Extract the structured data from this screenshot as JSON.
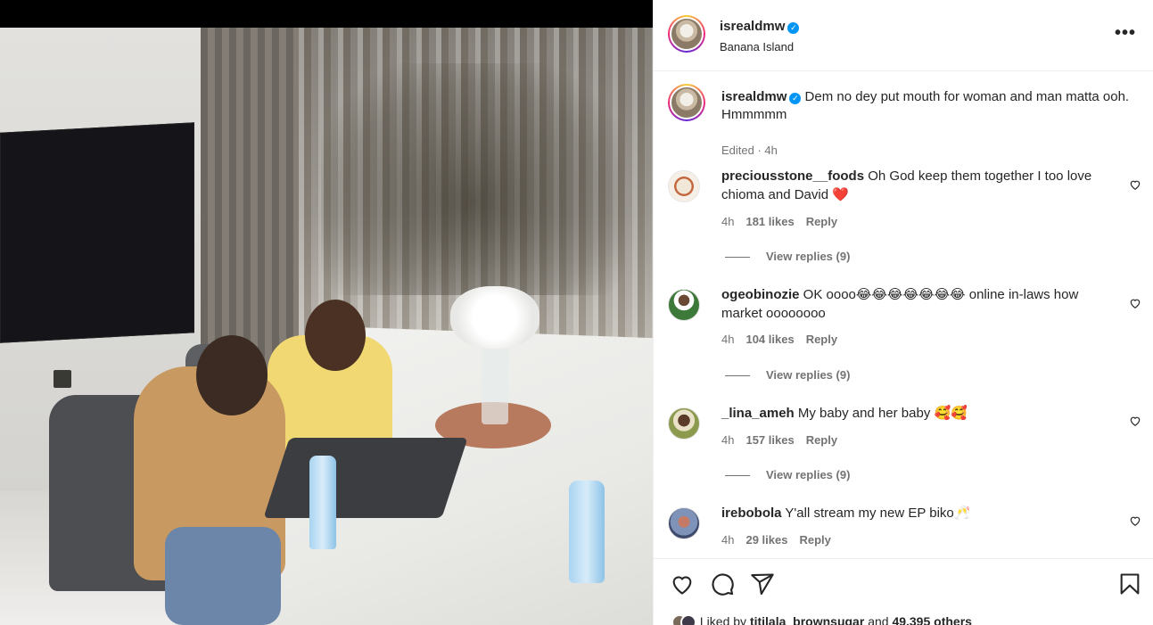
{
  "post": {
    "username": "isrealdmw",
    "location": "Banana Island",
    "more_label": "•••"
  },
  "caption": {
    "username": "isrealdmw",
    "text": "Dem no dey put mouth for woman and man matta ooh. Hmmmmm",
    "meta": "Edited · 4h"
  },
  "comments": [
    {
      "username": "preciousstone__foods",
      "text": "Oh God keep them together I too love chioma and David",
      "emoji": "❤️",
      "time": "4h",
      "likes": "181 likes",
      "reply": "Reply",
      "view_replies": "View replies (9)"
    },
    {
      "username": "ogeobinozie",
      "text": "OK oooo😂😂😂😂😂😂😂 online in-laws how market oooooooo",
      "emoji": "",
      "time": "4h",
      "likes": "104 likes",
      "reply": "Reply",
      "view_replies": "View replies (9)"
    },
    {
      "username": "_lina_ameh",
      "text": "My baby and her baby 🥰🥰",
      "emoji": "",
      "time": "4h",
      "likes": "157 likes",
      "reply": "Reply",
      "view_replies": "View replies (9)"
    },
    {
      "username": "irebobola",
      "text": "Y'all stream my new EP biko🥂",
      "emoji": "",
      "time": "4h",
      "likes": "29 likes",
      "reply": "Reply"
    }
  ],
  "footer": {
    "liked_by_prefix": "Liked by",
    "liked_by_user": "titilala_brownsugar",
    "liked_by_and": "and",
    "liked_by_others": "49,395 others"
  },
  "icons": {
    "like": "heart-icon",
    "comment": "comment-icon",
    "share": "share-icon",
    "save": "bookmark-icon"
  },
  "colors": {
    "verified": "#0095f6",
    "muted": "#737373",
    "heart_red": "#ed1c24"
  }
}
